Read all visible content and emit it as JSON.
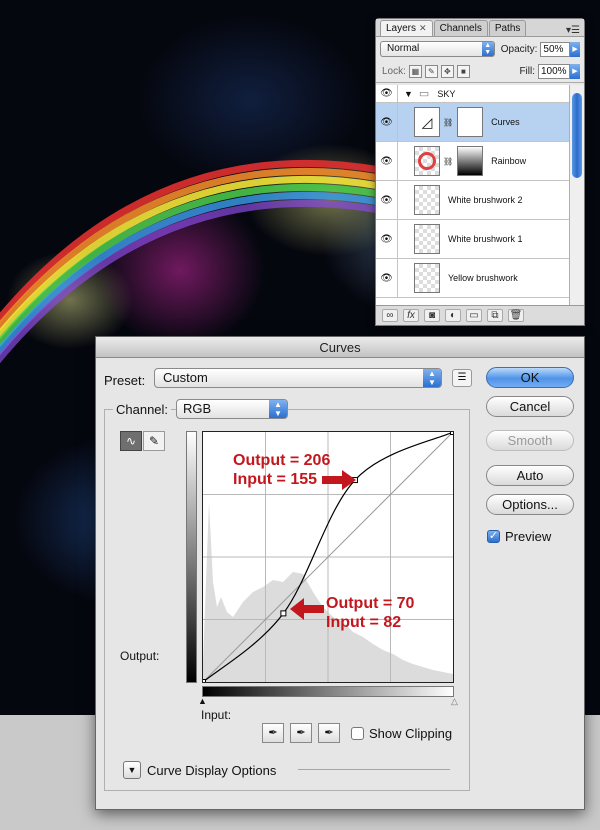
{
  "layers_panel": {
    "tabs": [
      "Layers",
      "Channels",
      "Paths"
    ],
    "blend_mode": "Normal",
    "opacity_label": "Opacity:",
    "opacity_value": "50%",
    "lock_label": "Lock:",
    "fill_label": "Fill:",
    "fill_value": "100%",
    "group_name": "SKY",
    "layers": [
      {
        "name": "Curves"
      },
      {
        "name": "Rainbow"
      },
      {
        "name": "White brushwork 2"
      },
      {
        "name": "White brushwork 1"
      },
      {
        "name": "Yellow brushwork"
      }
    ],
    "bottom_icons": [
      "link-icon",
      "fx-icon",
      "mask-icon",
      "adjustment-icon",
      "folder-icon",
      "new-layer-icon",
      "trash-icon"
    ]
  },
  "curves_dialog": {
    "title": "Curves",
    "preset_label": "Preset:",
    "preset_value": "Custom",
    "channel_label": "Channel:",
    "channel_value": "RGB",
    "output_label": "Output:",
    "input_label": "Input:",
    "show_clipping_label": "Show Clipping",
    "curve_display_options_label": "Curve Display Options",
    "buttons": {
      "ok": "OK",
      "cancel": "Cancel",
      "smooth": "Smooth",
      "auto": "Auto",
      "options": "Options..."
    },
    "preview_label": "Preview",
    "preview_checked": true,
    "curve_points": [
      {
        "input": 0,
        "output": 0
      },
      {
        "input": 82,
        "output": 70
      },
      {
        "input": 155,
        "output": 206
      },
      {
        "input": 255,
        "output": 255
      }
    ]
  },
  "annotations": [
    {
      "line1": "Output = 206",
      "line2": "Input = 155"
    },
    {
      "line1": "Output = 70",
      "line2": "Input = 82"
    }
  ],
  "colors": {
    "annotation_red": "#c3171e",
    "selection_blue": "#b6d2f0",
    "ok_button_blue": "#4f93e8"
  }
}
